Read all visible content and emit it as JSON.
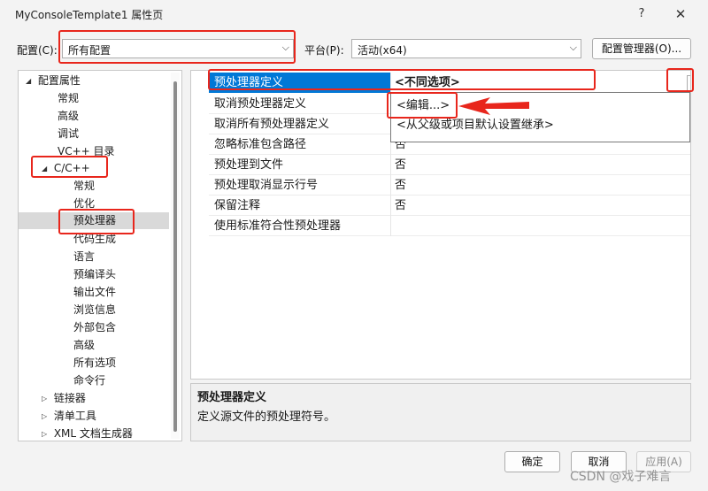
{
  "window": {
    "title": "MyConsoleTemplate1 属性页",
    "help_label": "?",
    "close_label": "✕"
  },
  "toolbar": {
    "config_label": "配置(C):",
    "config_value": "所有配置",
    "platform_label": "平台(P):",
    "platform_value": "活动(x64)",
    "config_manager_label": "配置管理器(O)..."
  },
  "tree": {
    "items": [
      {
        "label": "配置属性",
        "expander": "◢"
      },
      {
        "label": "常规"
      },
      {
        "label": "高级"
      },
      {
        "label": "调试"
      },
      {
        "label": "VC++ 目录"
      },
      {
        "label": "C/C++",
        "expander": "◢"
      },
      {
        "label": "常规"
      },
      {
        "label": "优化"
      },
      {
        "label": "预处理器"
      },
      {
        "label": "代码生成"
      },
      {
        "label": "语言"
      },
      {
        "label": "预编译头"
      },
      {
        "label": "输出文件"
      },
      {
        "label": "浏览信息"
      },
      {
        "label": "外部包含"
      },
      {
        "label": "高级"
      },
      {
        "label": "所有选项"
      },
      {
        "label": "命令行"
      },
      {
        "label": "链接器",
        "expander": "▷"
      },
      {
        "label": "清单工具",
        "expander": "▷"
      },
      {
        "label": "XML 文档生成器",
        "expander": "▷"
      }
    ]
  },
  "properties": {
    "rows": [
      {
        "name": "预处理器定义",
        "value": "<不同选项>"
      },
      {
        "name": "取消预处理器定义",
        "value": ""
      },
      {
        "name": "取消所有预处理器定义",
        "value": ""
      },
      {
        "name": "忽略标准包含路径",
        "value": "否"
      },
      {
        "name": "预处理到文件",
        "value": "否"
      },
      {
        "name": "预处理取消显示行号",
        "value": "否"
      },
      {
        "name": "保留注释",
        "value": "否"
      },
      {
        "name": "使用标准符合性预处理器",
        "value": ""
      }
    ],
    "dropdown_arrow": "⌵"
  },
  "dropdown": {
    "options": [
      "<编辑...>",
      "<从父级或项目默认设置继承>"
    ]
  },
  "description": {
    "title": "预处理器定义",
    "text": "定义源文件的预处理符号。"
  },
  "buttons": {
    "ok": "确定",
    "cancel": "取消",
    "apply": "应用(A)"
  },
  "watermark": "CSDN @戏子难言",
  "colors": {
    "accent": "#0078d7",
    "annotation": "#e8261c"
  }
}
